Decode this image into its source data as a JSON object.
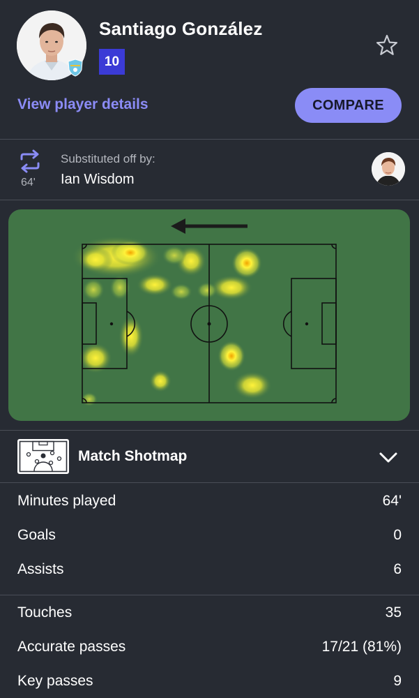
{
  "player": {
    "name": "Santiago González",
    "number": "10"
  },
  "links": {
    "view_details": "View player details",
    "compare": "COMPARE"
  },
  "substitution": {
    "minute": "64'",
    "label": "Substituted off by:",
    "player": "Ian Wisdom"
  },
  "shotmap": {
    "title": "Match Shotmap"
  },
  "stats_group_1": [
    {
      "label": "Minutes played",
      "value": "64'"
    },
    {
      "label": "Goals",
      "value": "0"
    },
    {
      "label": "Assists",
      "value": "6"
    }
  ],
  "stats_group_2": [
    {
      "label": "Touches",
      "value": "35"
    },
    {
      "label": "Accurate passes",
      "value": "17/21 (81%)"
    },
    {
      "label": "Key passes",
      "value": "9"
    }
  ],
  "colors": {
    "background": "#272b33",
    "accent": "#8a8cf6",
    "number_badge": "#3b3bd6",
    "pitch": "#417546"
  },
  "icons": [
    "star-icon",
    "substitution-icon",
    "chevron-down-icon",
    "attack-direction-arrow-icon"
  ]
}
